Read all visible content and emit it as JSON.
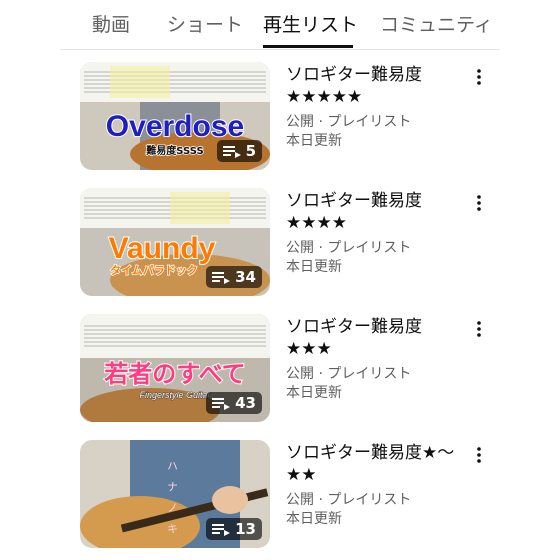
{
  "tabs": [
    {
      "label": "動画"
    },
    {
      "label": "ショート"
    },
    {
      "label": "再生リスト"
    },
    {
      "label": "コミュニティ"
    }
  ],
  "playlists": [
    {
      "thumbnail_text": "Overdose",
      "thumbnail_subtext": "難易度SSSS",
      "video_count": "5",
      "title_line1": "ソロギター難易度",
      "title_line2": "★★★★★",
      "visibility": "公開 · プレイリスト",
      "updated": "本日更新"
    },
    {
      "thumbnail_text": "Vaundy",
      "thumbnail_subtext": "タイムパラドック",
      "video_count": "34",
      "title_line1": "ソロギター難易度",
      "title_line2": "★★★★",
      "visibility": "公開 · プレイリスト",
      "updated": "本日更新"
    },
    {
      "thumbnail_text": "若者のすべて",
      "thumbnail_subtext": "Fingerstyle Guitar",
      "video_count": "43",
      "title_line1": "ソロギター難易度",
      "title_line2": "★★★",
      "visibility": "公開 · プレイリスト",
      "updated": "本日更新"
    },
    {
      "thumbnail_text": "ハナノキ",
      "thumbnail_subtext": "",
      "video_count": "13",
      "title_line1": "ソロギター難易度★〜",
      "title_line2": "★★",
      "visibility": "公開 · プレイリスト",
      "updated": "本日更新"
    }
  ],
  "colors": {
    "text_primary": "#0f0f0f",
    "text_secondary": "#606060",
    "thumb_overdose": "#1f1fbf",
    "thumb_vaundy": "#ff7a00",
    "thumb_wakamono": "#ff3c7f"
  }
}
